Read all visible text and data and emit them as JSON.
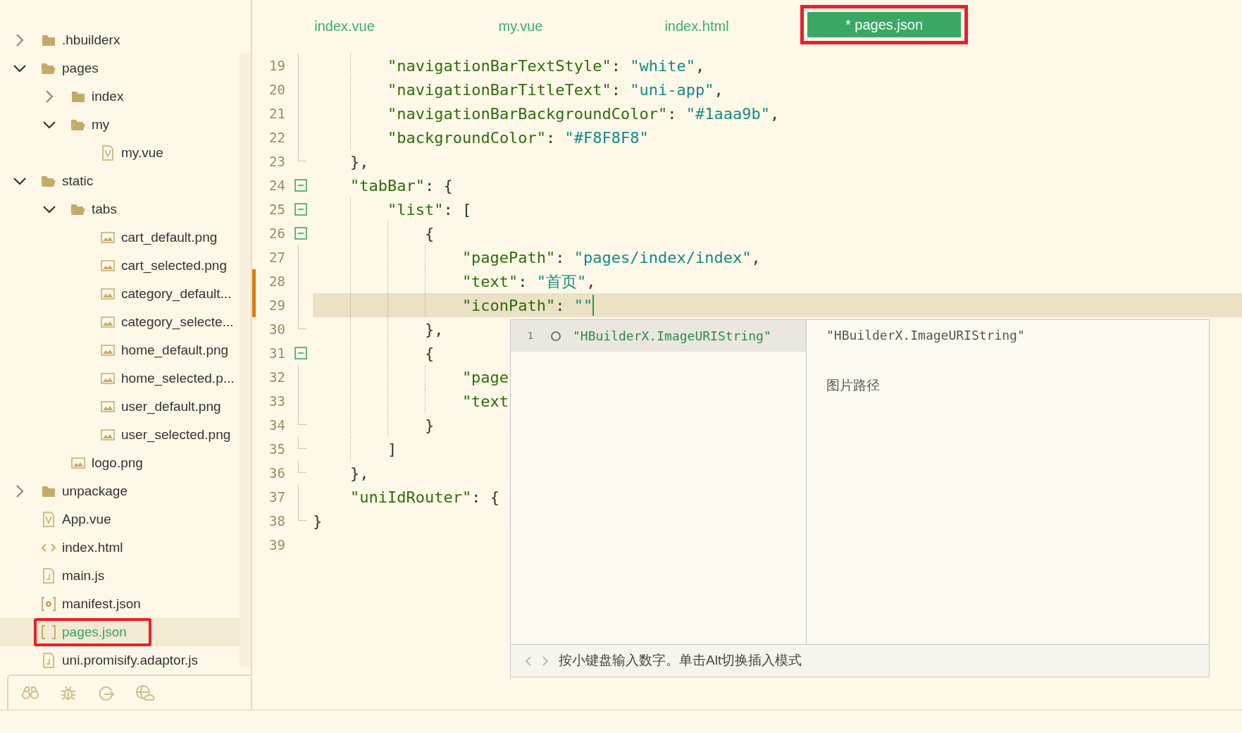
{
  "sidebar": {
    "tree": [
      {
        "label": ".hbuilderx",
        "kind": "folder",
        "expanded": false,
        "selected": false,
        "outlined": false
      },
      {
        "label": "pages",
        "kind": "folder",
        "expanded": true,
        "selected": false,
        "outlined": false,
        "children": [
          {
            "label": "index",
            "kind": "folder",
            "expanded": false,
            "selected": false,
            "outlined": false
          },
          {
            "label": "my",
            "kind": "folder",
            "expanded": true,
            "selected": false,
            "outlined": false,
            "children": [
              {
                "label": "my.vue",
                "kind": "vue",
                "selected": false,
                "outlined": false
              }
            ]
          }
        ]
      },
      {
        "label": "static",
        "kind": "folder",
        "expanded": true,
        "selected": false,
        "outlined": false,
        "children": [
          {
            "label": "tabs",
            "kind": "folder",
            "expanded": true,
            "selected": false,
            "outlined": false,
            "children": [
              {
                "label": "cart_default.png",
                "kind": "image",
                "selected": false,
                "outlined": false
              },
              {
                "label": "cart_selected.png",
                "kind": "image",
                "selected": false,
                "outlined": false
              },
              {
                "label": "category_default...",
                "kind": "image",
                "selected": false,
                "outlined": false
              },
              {
                "label": "category_selecte...",
                "kind": "image",
                "selected": false,
                "outlined": false
              },
              {
                "label": "home_default.png",
                "kind": "image",
                "selected": false,
                "outlined": false
              },
              {
                "label": "home_selected.p...",
                "kind": "image",
                "selected": false,
                "outlined": false
              },
              {
                "label": "user_default.png",
                "kind": "image",
                "selected": false,
                "outlined": false
              },
              {
                "label": "user_selected.png",
                "kind": "image",
                "selected": false,
                "outlined": false
              }
            ]
          },
          {
            "label": "logo.png",
            "kind": "image",
            "selected": false,
            "outlined": false
          }
        ]
      },
      {
        "label": "unpackage",
        "kind": "folder",
        "expanded": false,
        "selected": false,
        "outlined": false
      },
      {
        "label": "App.vue",
        "kind": "vue",
        "selected": false,
        "outlined": false
      },
      {
        "label": "index.html",
        "kind": "html",
        "selected": false,
        "outlined": false
      },
      {
        "label": "main.js",
        "kind": "js",
        "selected": false,
        "outlined": false
      },
      {
        "label": "manifest.json",
        "kind": "settings",
        "selected": false,
        "outlined": false
      },
      {
        "label": "pages.json",
        "kind": "json",
        "selected": true,
        "outlined": true
      },
      {
        "label": "uni.promisify.adaptor.js",
        "kind": "js",
        "selected": false,
        "outlined": false
      }
    ],
    "footer_tools": true
  },
  "tabs": [
    {
      "label": "index.vue",
      "selected": false,
      "outlined": false
    },
    {
      "label": "my.vue",
      "selected": false,
      "outlined": false
    },
    {
      "label": "index.html",
      "selected": false,
      "outlined": false
    },
    {
      "label": "* pages.json",
      "selected": true,
      "outlined": true
    }
  ],
  "code_lines": [
    {
      "number": "19",
      "text": "        \"navigationBarTextStyle\": \"white\",",
      "kind": "line",
      "current": false,
      "modified": false
    },
    {
      "number": "20",
      "text": "        \"navigationBarTitleText\": \"uni-app\",",
      "kind": "line",
      "current": false,
      "modified": false
    },
    {
      "number": "21",
      "text": "        \"navigationBarBackgroundColor\": \"#1aaa9b\",",
      "kind": "line",
      "current": false,
      "modified": false
    },
    {
      "number": "22",
      "text": "        \"backgroundColor\": \"#F8F8F8\"",
      "kind": "line",
      "current": false,
      "modified": false
    },
    {
      "number": "23",
      "text": "    },",
      "kind": "end",
      "current": false,
      "modified": false
    },
    {
      "number": "24",
      "text": "    \"tabBar\": {",
      "kind": "fold",
      "current": false,
      "modified": false
    },
    {
      "number": "25",
      "text": "        \"list\": [",
      "kind": "fold",
      "current": false,
      "modified": false
    },
    {
      "number": "26",
      "text": "            {",
      "kind": "fold",
      "current": false,
      "modified": false
    },
    {
      "number": "27",
      "text": "                \"pagePath\": \"pages/index/index\",",
      "kind": "line",
      "current": false,
      "modified": false
    },
    {
      "number": "28",
      "text": "                \"text\": \"首页\",",
      "kind": "line",
      "current": false,
      "modified": true
    },
    {
      "number": "29",
      "text": "                \"iconPath\": \"\"",
      "kind": "line",
      "current": true,
      "modified": true
    },
    {
      "number": "30",
      "text": "            },",
      "kind": "end",
      "current": false,
      "modified": false
    },
    {
      "number": "31",
      "text": "            {",
      "kind": "fold",
      "current": false,
      "modified": false
    },
    {
      "number": "32",
      "text": "                \"page",
      "kind": "line",
      "current": false,
      "modified": false
    },
    {
      "number": "33",
      "text": "                \"text",
      "kind": "line",
      "current": false,
      "modified": false
    },
    {
      "number": "34",
      "text": "            }",
      "kind": "end",
      "current": false,
      "modified": false
    },
    {
      "number": "35",
      "text": "        ]",
      "kind": "end",
      "current": false,
      "modified": false
    },
    {
      "number": "36",
      "text": "    },",
      "kind": "end",
      "current": false,
      "modified": false
    },
    {
      "number": "37",
      "text": "    \"uniIdRouter\": {",
      "kind": "line",
      "current": false,
      "modified": false
    },
    {
      "number": "38",
      "text": "}",
      "kind": "end",
      "current": false,
      "modified": false
    },
    {
      "number": "39",
      "kind": "none",
      "current": false,
      "modified": false
    }
  ],
  "completion": {
    "items": [
      {
        "number": "1",
        "label": "\"HBuilderX.ImageURIString\"",
        "selected": true
      }
    ],
    "detail_title": "\"HBuilderX.ImageURIString\"",
    "detail_description": "图片路径",
    "footer": "按小键盘输入数字。单击Alt切换插入模式"
  }
}
